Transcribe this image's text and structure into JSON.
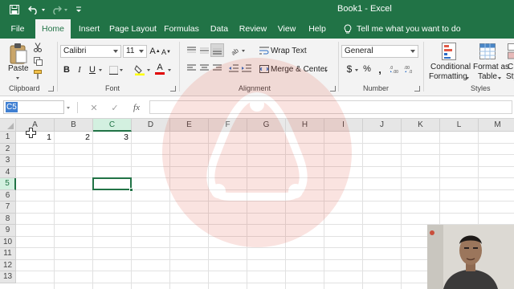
{
  "app": {
    "title": "Book1  -  Excel"
  },
  "tabs": [
    {
      "label": "File",
      "active": false
    },
    {
      "label": "Home",
      "active": true
    },
    {
      "label": "Insert",
      "active": false
    },
    {
      "label": "Page Layout",
      "active": false
    },
    {
      "label": "Formulas",
      "active": false
    },
    {
      "label": "Data",
      "active": false
    },
    {
      "label": "Review",
      "active": false
    },
    {
      "label": "View",
      "active": false
    },
    {
      "label": "Help",
      "active": false
    }
  ],
  "tell_me": "Tell me what you want to do",
  "ribbon": {
    "clipboard": {
      "label": "Clipboard",
      "paste": "Paste"
    },
    "font": {
      "label": "Font",
      "name": "Calibri",
      "size": "11",
      "bold": "B",
      "italic": "I",
      "underline": "U",
      "grow": "A",
      "shrink": "A",
      "font_color": "A"
    },
    "alignment": {
      "label": "Alignment",
      "wrap_text": "Wrap Text",
      "merge_center": "Merge & Center"
    },
    "number": {
      "label": "Number",
      "format": "General",
      "currency": "$",
      "percent": "%",
      "comma": ","
    },
    "styles": {
      "label": "Styles",
      "conditional_1": "Conditional",
      "conditional_2": "Formatting",
      "format_table_1": "Format as",
      "format_table_2": "Table",
      "cell_styles_1": "C",
      "cell_styles_2": "Sty"
    }
  },
  "formula_bar": {
    "name_box": "C5",
    "fx": "fx",
    "cancel": "✕",
    "enter": "✓",
    "content": ""
  },
  "sheet": {
    "columns": [
      "A",
      "B",
      "C",
      "D",
      "E",
      "F",
      "G",
      "H",
      "I",
      "J",
      "K",
      "L",
      "M"
    ],
    "rows": [
      "1",
      "2",
      "3",
      "4",
      "5",
      "6",
      "7",
      "8",
      "9",
      "10",
      "11",
      "12",
      "13"
    ],
    "selected_column": "C",
    "selected_row": "5",
    "active_cell": "C5",
    "cells": [
      {
        "ref": "A1",
        "value": "1"
      },
      {
        "ref": "B1",
        "value": "2"
      },
      {
        "ref": "C1",
        "value": "3"
      }
    ]
  },
  "colors": {
    "excel_green": "#217346",
    "ribbon_bg": "#f3f3f3",
    "header_bg": "#e6e6e6",
    "header_selected_bg": "#d3f0e0",
    "name_box_highlight": "#3f7fd2",
    "watermark": "#e0402a"
  },
  "icons": {
    "save": "save-icon",
    "undo": "undo-icon",
    "redo": "redo-icon",
    "customize": "customize-qat-icon",
    "lightbulb": "lightbulb-icon"
  }
}
